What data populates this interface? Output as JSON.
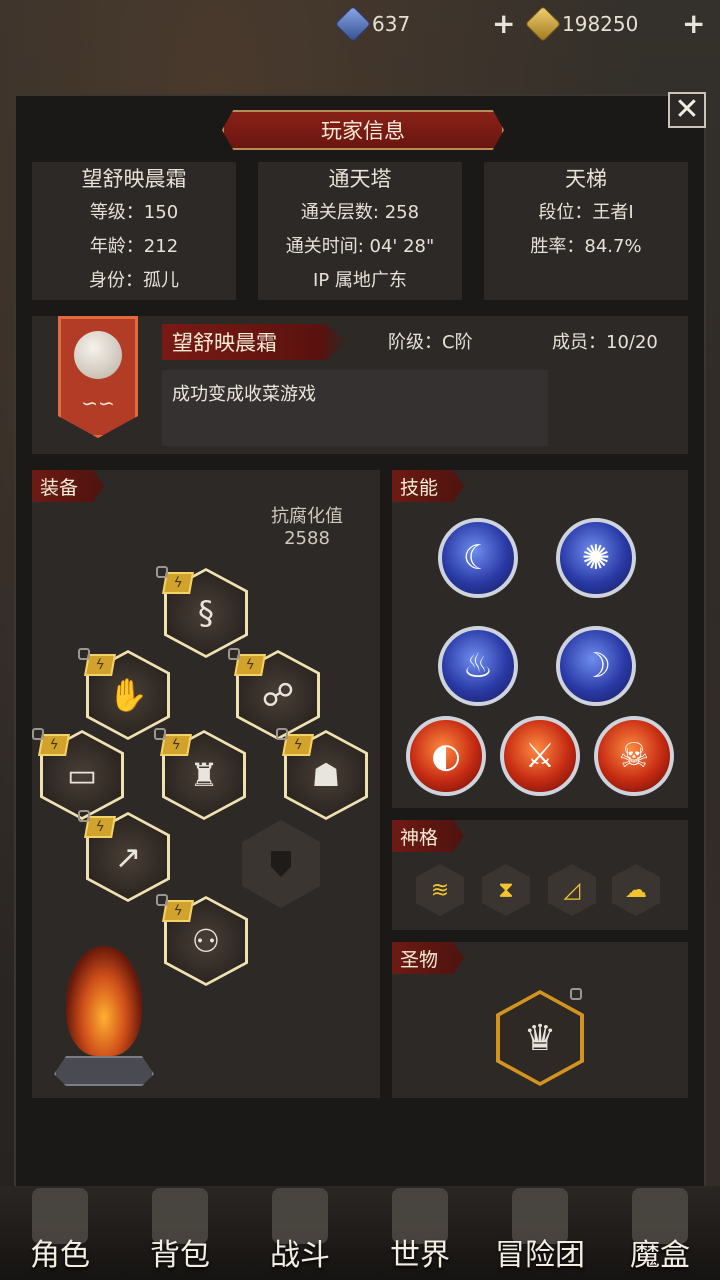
{
  "currency": {
    "gems": "637",
    "gold": "198250",
    "gem_icon": "blue-crystal-icon",
    "gold_icon": "gold-ingot-icon"
  },
  "dialog": {
    "title": "玩家信息",
    "close_label": "✕"
  },
  "player": {
    "name": "望舒映晨霜",
    "level": "等级：150",
    "age": "年龄：212",
    "identity": "身份：孤儿"
  },
  "tower": {
    "title": "通天塔",
    "floors": "通关层数: 258",
    "time": "通关时间: 04' 28\"",
    "ip": "IP 属地广东"
  },
  "ladder": {
    "title": "天梯",
    "rank": "段位：王者I",
    "winrate": "胜率：84.7%"
  },
  "guild": {
    "name": "望舒映晨霜",
    "rank": "阶级：C阶",
    "members": "成员：10/20",
    "motto": "成功变成收菜游戏"
  },
  "equipment": {
    "tag": "装备",
    "resist_label": "抗腐化值",
    "resist_value": "2588",
    "slots": [
      {
        "icon": "scarf-icon",
        "glyph": "§"
      },
      {
        "icon": "gauntlet-icon",
        "glyph": "✋"
      },
      {
        "icon": "amulet-icon",
        "glyph": "☍"
      },
      {
        "icon": "belt-icon",
        "glyph": "▭"
      },
      {
        "icon": "armor-icon",
        "glyph": "♜"
      },
      {
        "icon": "cloak-icon",
        "glyph": "☗"
      },
      {
        "icon": "spear-icon",
        "glyph": "↗"
      },
      {
        "icon": "boots-icon",
        "glyph": "⚇"
      }
    ]
  },
  "skills": {
    "tag": "技能",
    "items": [
      {
        "icon": "crescent-skill-icon",
        "glyph": "☾",
        "color": "#2a3aa6"
      },
      {
        "icon": "sun-orb-skill-icon",
        "glyph": "✺",
        "color": "#2a3aa6"
      },
      {
        "icon": "blue-flame-skill-icon",
        "glyph": "♨",
        "color": "#2a3aa6"
      },
      {
        "icon": "moon-slash-skill-icon",
        "glyph": "☽",
        "color": "#2a3aa6"
      },
      {
        "icon": "fire-crescent-skill-icon",
        "glyph": "◐",
        "color": "#c52a12"
      },
      {
        "icon": "fire-sword-skill-icon",
        "glyph": "⚔",
        "color": "#c52a12"
      },
      {
        "icon": "demon-mask-skill-icon",
        "glyph": "☠",
        "color": "#c52a12"
      }
    ]
  },
  "divinity": {
    "tag": "神格",
    "items": [
      {
        "icon": "lightning-waves-icon",
        "glyph": "≋"
      },
      {
        "icon": "hourglass-icon",
        "glyph": "⧗"
      },
      {
        "icon": "horn-icon",
        "glyph": "◿"
      },
      {
        "icon": "ghost-icon",
        "glyph": "☁"
      }
    ]
  },
  "relic": {
    "tag": "圣物",
    "icon": "crown-icon",
    "glyph": "♛"
  },
  "nav": [
    {
      "label": "角色",
      "icon": "knight-helmet-icon"
    },
    {
      "label": "背包",
      "icon": "backpack-icon"
    },
    {
      "label": "战斗",
      "icon": "crossed-swords-icon"
    },
    {
      "label": "世界",
      "icon": "map-icon"
    },
    {
      "label": "冒险团",
      "icon": "castle-icon"
    },
    {
      "label": "魔盒",
      "icon": "magic-box-icon"
    }
  ]
}
